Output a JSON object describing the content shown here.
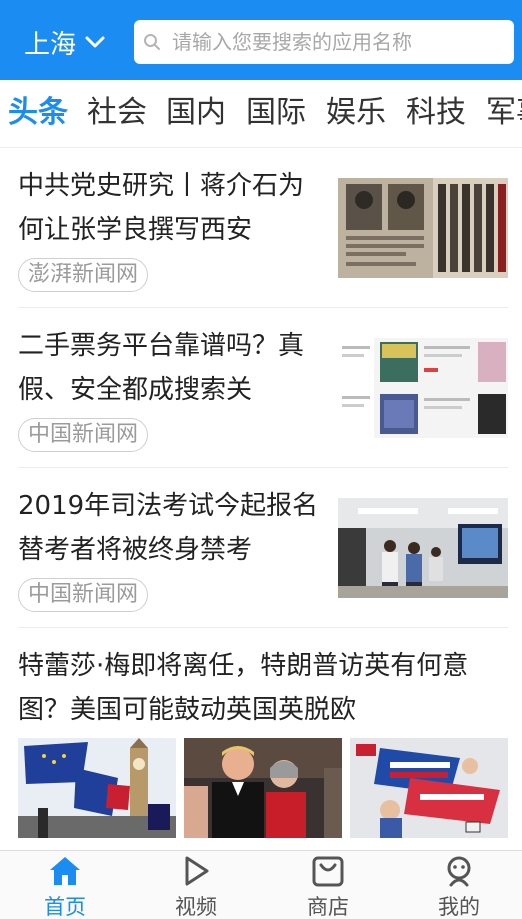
{
  "header": {
    "city": "上海",
    "search_placeholder": "请输入您要搜索的应用名称"
  },
  "tabs": [
    {
      "label": "头条",
      "active": true
    },
    {
      "label": "社会"
    },
    {
      "label": "国内"
    },
    {
      "label": "国际"
    },
    {
      "label": "娱乐"
    },
    {
      "label": "科技"
    },
    {
      "label": "军事"
    }
  ],
  "feed": [
    {
      "title": "中共党史研究丨蒋介石为何让张学良撰写西安",
      "source": "澎湃新闻网",
      "thumb": "newspaper-archive-photo"
    },
    {
      "title": "二手票务平台靠谱吗？真假、安全都成搜索关",
      "source": "中国新闻网",
      "thumb": "ticket-app-screenshot"
    },
    {
      "title": "2019年司法考试今起报名 替考者将被终身禁考",
      "source": "中国新闻网",
      "thumb": "exam-room-photo"
    },
    {
      "title": "特蕾莎·梅即将离任，特朗普访英有何意图？美国可能鼓动英国英脱欧",
      "thumbs": [
        "eu-flags-big-ben-photo",
        "trump-may-photo",
        "brexit-cartoon-image"
      ]
    }
  ],
  "bottom_nav": [
    {
      "label": "首页",
      "icon": "home-icon",
      "active": true
    },
    {
      "label": "视频",
      "icon": "video-play-icon"
    },
    {
      "label": "商店",
      "icon": "store-bag-icon"
    },
    {
      "label": "我的",
      "icon": "profile-icon"
    }
  ],
  "colors": {
    "accent": "#1a8cf2",
    "text": "#222222",
    "muted": "#9b9b9b"
  }
}
